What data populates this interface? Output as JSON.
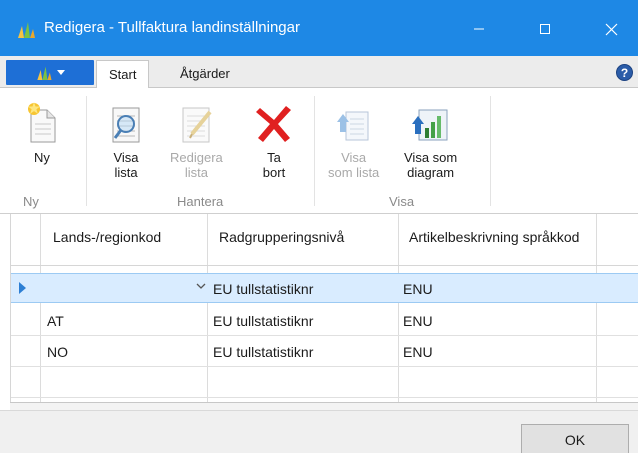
{
  "window": {
    "title": "Redigera - Tullfaktura landinställningar",
    "accent_color": "#1e88e5"
  },
  "tabs": [
    {
      "label": "Start",
      "active": true
    },
    {
      "label": "Åtgärder",
      "active": false
    }
  ],
  "help_label": "?",
  "ribbon": {
    "groups": [
      {
        "label": "Ny",
        "buttons": [
          {
            "line1": "Ny",
            "line2": "",
            "icon": "new-document-icon",
            "enabled": true
          }
        ]
      },
      {
        "label": "Hantera",
        "buttons": [
          {
            "line1": "Visa",
            "line2": "lista",
            "icon": "view-list-icon",
            "enabled": true
          },
          {
            "line1": "Redigera",
            "line2": "lista",
            "icon": "edit-list-icon",
            "enabled": false
          },
          {
            "line1": "Ta",
            "line2": "bort",
            "icon": "delete-icon",
            "enabled": true
          }
        ]
      },
      {
        "label": "Visa",
        "buttons": [
          {
            "line1": "Visa",
            "line2": "som lista",
            "icon": "show-as-list-icon",
            "enabled": false
          },
          {
            "line1": "Visa som",
            "line2": "diagram",
            "icon": "show-as-chart-icon",
            "enabled": true
          }
        ]
      }
    ]
  },
  "grid": {
    "columns": [
      {
        "label": "Lands-/regionkod"
      },
      {
        "label": "Radgrupperingsnivå"
      },
      {
        "label": "Artikelbeskrivning språkkod"
      }
    ],
    "rows": [
      {
        "country": "",
        "level": "EU tullstatistiknr",
        "lang": "ENU",
        "selected": true
      },
      {
        "country": "AT",
        "level": "EU tullstatistiknr",
        "lang": "ENU",
        "selected": false
      },
      {
        "country": "NO",
        "level": "EU tullstatistiknr",
        "lang": "ENU",
        "selected": false
      },
      {
        "country": "",
        "level": "",
        "lang": "",
        "selected": false
      }
    ]
  },
  "footer": {
    "ok_label": "OK"
  }
}
